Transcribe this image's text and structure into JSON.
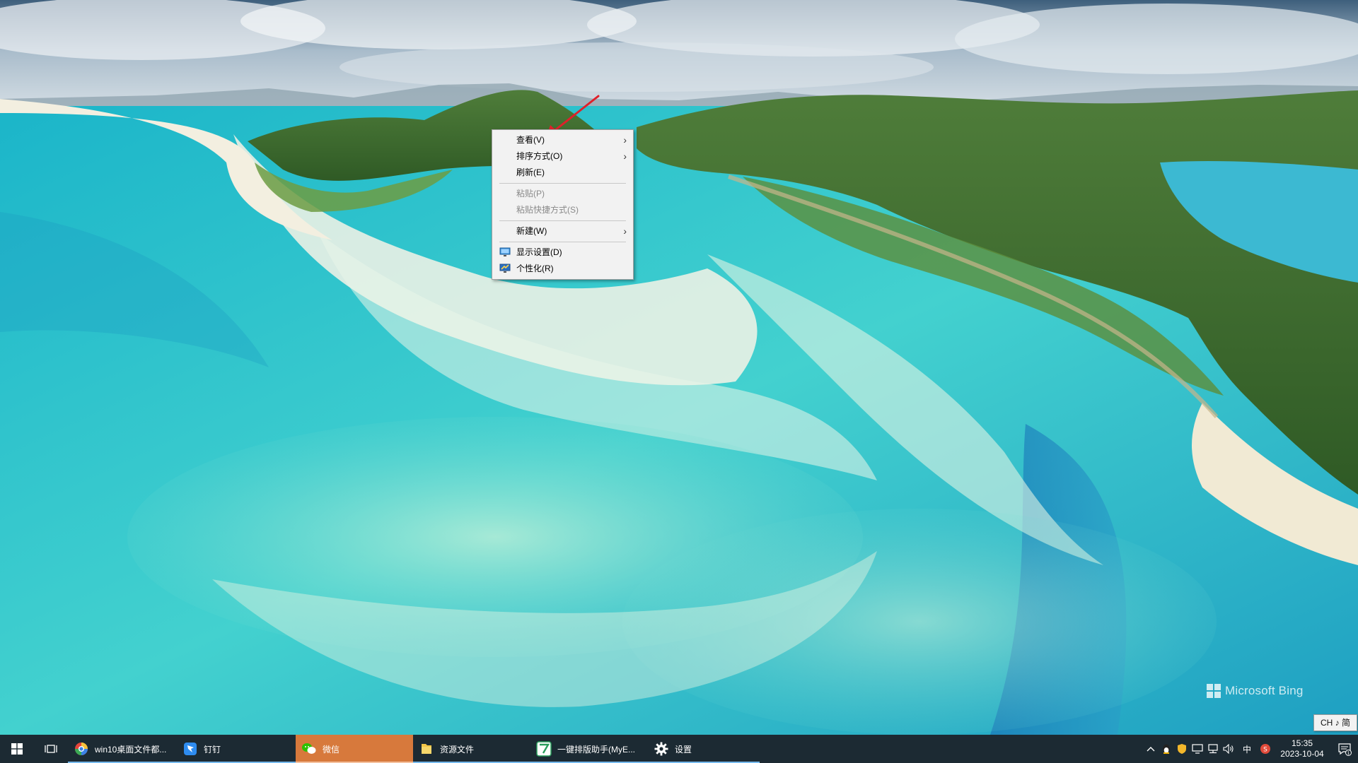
{
  "desktop": {
    "watermark_text": "Microsoft Bing"
  },
  "context_menu": {
    "items": [
      {
        "label": "查看(V)",
        "submenu": true,
        "disabled": false
      },
      {
        "label": "排序方式(O)",
        "submenu": true,
        "disabled": false
      },
      {
        "label": "刷新(E)",
        "submenu": false,
        "disabled": false
      },
      {
        "label": "粘贴(P)",
        "submenu": false,
        "disabled": true
      },
      {
        "label": "粘贴快捷方式(S)",
        "submenu": false,
        "disabled": true
      },
      {
        "label": "新建(W)",
        "submenu": true,
        "disabled": false
      },
      {
        "label": "显示设置(D)",
        "icon": "display-settings-icon",
        "disabled": false
      },
      {
        "label": "个性化(R)",
        "icon": "personalize-icon",
        "disabled": false
      }
    ],
    "submenu_glyph": "›"
  },
  "taskbar": {
    "apps": [
      {
        "label": "win10桌面文件都...",
        "icon": "browser-icon"
      },
      {
        "label": "钉钉",
        "icon": "dingtalk-icon"
      },
      {
        "label": "微信",
        "icon": "wechat-icon",
        "active": true
      },
      {
        "label": "资源文件",
        "icon": "folder-icon"
      },
      {
        "label": "一键排版助手(MyE...",
        "icon": "layout-assistant-icon"
      },
      {
        "label": "设置",
        "icon": "gear-icon"
      }
    ],
    "tray": {
      "ime_label": "中",
      "time": "15:35",
      "date": "2023-10-04",
      "notification_count": "1",
      "ime_popup": "CH ♪ 简"
    }
  },
  "colors": {
    "taskbar": "#1c2a33",
    "active_app": "#d7793c",
    "menu_bg": "#f2f2f2",
    "arrow": "#e0202a",
    "water": "#34c8cf",
    "forest": "#3f6f2c"
  }
}
